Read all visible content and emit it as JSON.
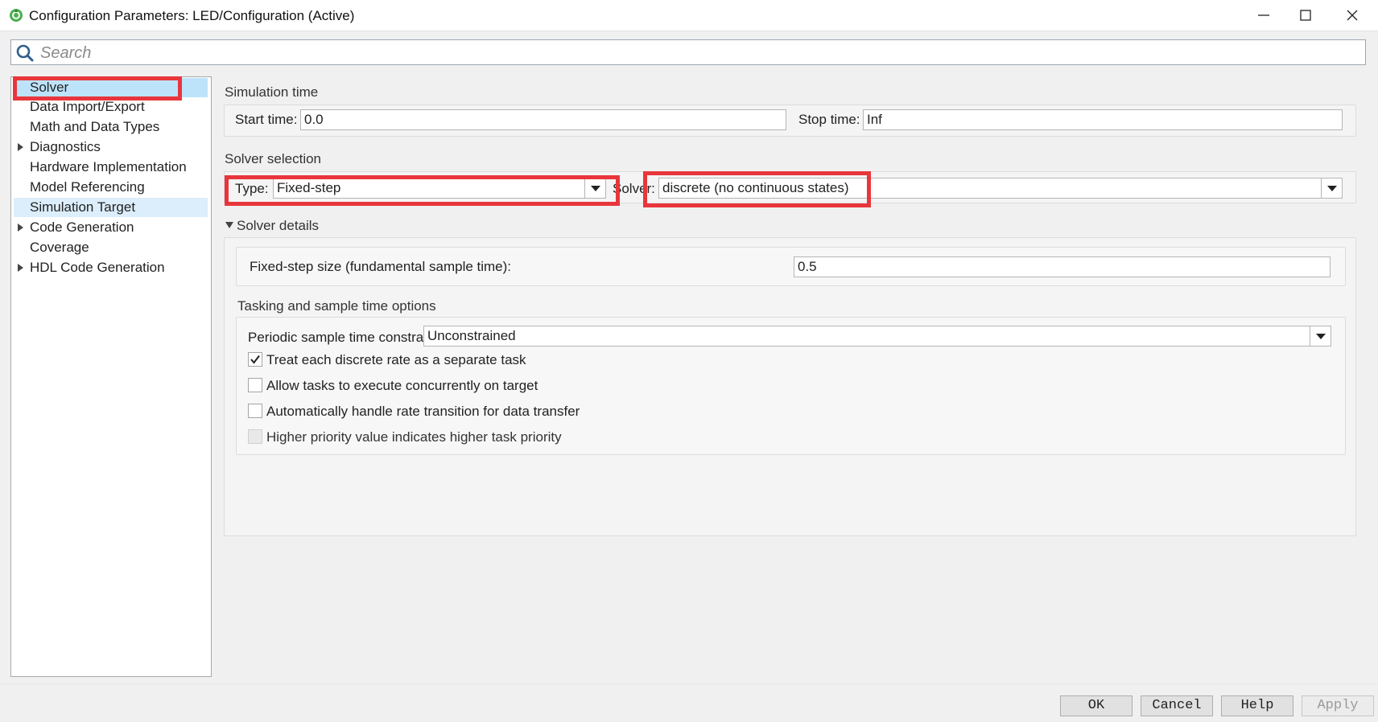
{
  "window": {
    "title": "Configuration Parameters: LED/Configuration (Active)",
    "minimize_icon": "minimize-icon",
    "maximize_icon": "maximize-icon",
    "close_icon": "close-icon"
  },
  "search": {
    "placeholder": "Search",
    "icon": "search-icon"
  },
  "nav": {
    "items": [
      {
        "label": "Solver",
        "expandable": false,
        "selected": true
      },
      {
        "label": "Data Import/Export",
        "expandable": false
      },
      {
        "label": "Math and Data Types",
        "expandable": false
      },
      {
        "label": "Diagnostics",
        "expandable": true
      },
      {
        "label": "Hardware Implementation",
        "expandable": false
      },
      {
        "label": "Model Referencing",
        "expandable": false
      },
      {
        "label": "Simulation Target",
        "expandable": false,
        "highlighted": true
      },
      {
        "label": "Code Generation",
        "expandable": true
      },
      {
        "label": "Coverage",
        "expandable": false
      },
      {
        "label": "HDL Code Generation",
        "expandable": true
      }
    ]
  },
  "simulation_time": {
    "heading": "Simulation time",
    "start_label": "Start time:",
    "start_value": "0.0",
    "stop_label": "Stop time:",
    "stop_value": "Inf"
  },
  "solver_selection": {
    "heading": "Solver selection",
    "type_label": "Type:",
    "type_value": "Fixed-step",
    "solver_label": "Solver:",
    "solver_value": "discrete (no continuous states)"
  },
  "solver_details": {
    "heading": "Solver details",
    "step_size_label": "Fixed-step size (fundamental sample time):",
    "step_size_value": "0.5"
  },
  "tasking": {
    "heading": "Tasking and sample time options",
    "constraint_label": "Periodic sample time constraint:",
    "constraint_value": "Unconstrained",
    "options": [
      {
        "label": "Treat each discrete rate as a separate task",
        "checked": true,
        "enabled": true
      },
      {
        "label": "Allow tasks to execute concurrently on target",
        "checked": false,
        "enabled": true
      },
      {
        "label": "Automatically handle rate transition for data transfer",
        "checked": false,
        "enabled": true
      },
      {
        "label": "Higher priority value indicates higher task priority",
        "checked": false,
        "enabled": false
      }
    ]
  },
  "buttons": {
    "ok": "OK",
    "cancel": "Cancel",
    "help": "Help",
    "apply": "Apply"
  },
  "colors": {
    "annotation_red": "#e8363c",
    "selected_bg": "#bde3fb"
  }
}
